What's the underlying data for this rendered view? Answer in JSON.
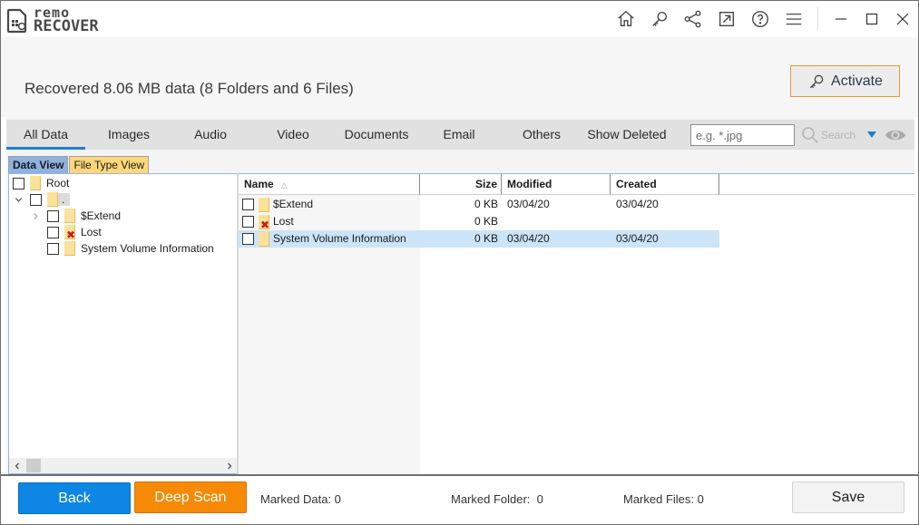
{
  "app": {
    "logo_top": "remo",
    "logo_bottom": "RECOVER",
    "title_icons": [
      "home-icon",
      "key-icon",
      "share-icon",
      "external-link-icon",
      "help-icon",
      "menu-icon"
    ],
    "window_controls": [
      "minimize-icon",
      "maximize-icon",
      "close-icon"
    ]
  },
  "header": {
    "summary": "Recovered 8.06 MB data (8 Folders and 6 Files)",
    "activate_label": "Activate"
  },
  "tabs": [
    {
      "label": "All Data",
      "active": true
    },
    {
      "label": "Images",
      "active": false
    },
    {
      "label": "Audio",
      "active": false
    },
    {
      "label": "Video",
      "active": false
    },
    {
      "label": "Documents",
      "active": false
    },
    {
      "label": "Email",
      "active": false
    },
    {
      "label": "Others",
      "active": false
    },
    {
      "label": "Show Deleted",
      "active": false
    }
  ],
  "filter": {
    "value": "",
    "placeholder": "e.g. *.jpg",
    "search_label": "Search"
  },
  "view_tabs": [
    {
      "label": "Data View",
      "active": true
    },
    {
      "label": "File Type View",
      "active": false
    }
  ],
  "tree": [
    {
      "label": "Root",
      "level": 0,
      "expander": "none",
      "deleted": false
    },
    {
      "label": ".",
      "level": 0,
      "expander": "expanded",
      "deleted": false
    },
    {
      "label": "$Extend",
      "level": 1,
      "expander": "collapsed",
      "deleted": false
    },
    {
      "label": "Lost",
      "level": 1,
      "expander": "none",
      "deleted": true
    },
    {
      "label": "System Volume Information",
      "level": 1,
      "expander": "none",
      "deleted": false
    }
  ],
  "list": {
    "columns": [
      "Name",
      "Size",
      "Modified",
      "Created"
    ],
    "rows": [
      {
        "name": "$Extend",
        "size": "0 KB",
        "modified": "03/04/20",
        "created": "03/04/20",
        "deleted": false,
        "selected": false
      },
      {
        "name": "Lost",
        "size": "0 KB",
        "modified": "",
        "created": "",
        "deleted": true,
        "selected": false
      },
      {
        "name": "System Volume Information",
        "size": "0 KB",
        "modified": "03/04/20",
        "created": "03/04/20",
        "deleted": false,
        "selected": true
      }
    ]
  },
  "footer": {
    "back_label": "Back",
    "deep_scan_label": "Deep Scan",
    "marked_data_label": "Marked Data:",
    "marked_data_value": "0",
    "marked_folder_label": "Marked Folder:",
    "marked_folder_value": "0",
    "marked_files_label": "Marked Files:",
    "marked_files_value": "0",
    "save_label": "Save"
  },
  "colors": {
    "accent_blue": "#0d86e6",
    "accent_orange": "#f68a06",
    "tab_underline": "#1e7fd0",
    "selection": "#cce4f7",
    "logo_red": "#c0272d"
  }
}
